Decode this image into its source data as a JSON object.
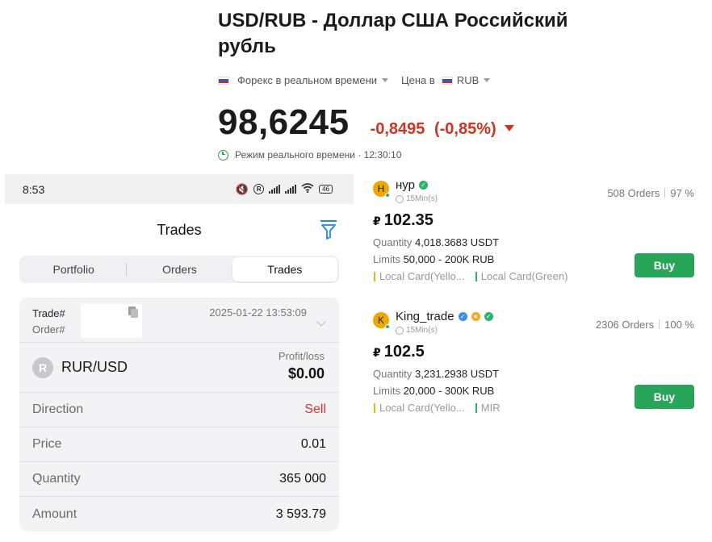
{
  "quote": {
    "title": "USD/RUB - Доллар США Российский рубль",
    "source": "Форекс в реальном времени",
    "price_in_label": "Цена в",
    "currency": "RUB",
    "price": "98,6245",
    "change": "-0,8495",
    "change_pct": "(-0,85%)",
    "realtime": "Режим реального времени · 12:30:10",
    "colors": {
      "negative": "#d0341f",
      "live": "#2e9e4b"
    }
  },
  "phone": {
    "status": {
      "time": "8:53",
      "battery": "46"
    },
    "title": "Trades",
    "tabs": [
      {
        "label": "Portfolio",
        "active": false
      },
      {
        "label": "Orders",
        "active": false
      },
      {
        "label": "Trades",
        "active": true
      }
    ],
    "card": {
      "trade_label": "Trade#",
      "order_label": "Order#",
      "datetime": "2025-01-22 13:53:09",
      "pair_icon": "R",
      "pair": "RUR/USD",
      "profit_label": "Profit/loss",
      "profit_value": "$0.00",
      "rows": [
        {
          "label": "Direction",
          "value": "Sell"
        },
        {
          "label": "Price",
          "value": "0.01"
        },
        {
          "label": "Quantity",
          "value": "365 000"
        },
        {
          "label": "Amount",
          "value": "3 593.79"
        }
      ]
    }
  },
  "offers": [
    {
      "avatar": "H",
      "name": "нур",
      "time": "15Min(s)",
      "orders": "508 Orders",
      "completion": "97 %",
      "currency_symbol": "₽",
      "price": "102.35",
      "quantity_label": "Quantity",
      "quantity": "4,018.3683 USDT",
      "limits_label": "Limits",
      "limits": "50,000 - 200K RUB",
      "methods": [
        "Local Card(Yello...",
        "Local Card(Green)"
      ],
      "button": "Buy"
    },
    {
      "avatar": "K",
      "name": "King_trade",
      "time": "15Min(s)",
      "orders": "2306 Orders",
      "completion": "100 %",
      "currency_symbol": "₽",
      "price": "102.5",
      "quantity_label": "Quantity",
      "quantity": "3,231.2938 USDT",
      "limits_label": "Limits",
      "limits": "20,000 - 300K RUB",
      "methods": [
        "Local Card(Yello...",
        "MIR"
      ],
      "button": "Buy"
    }
  ]
}
